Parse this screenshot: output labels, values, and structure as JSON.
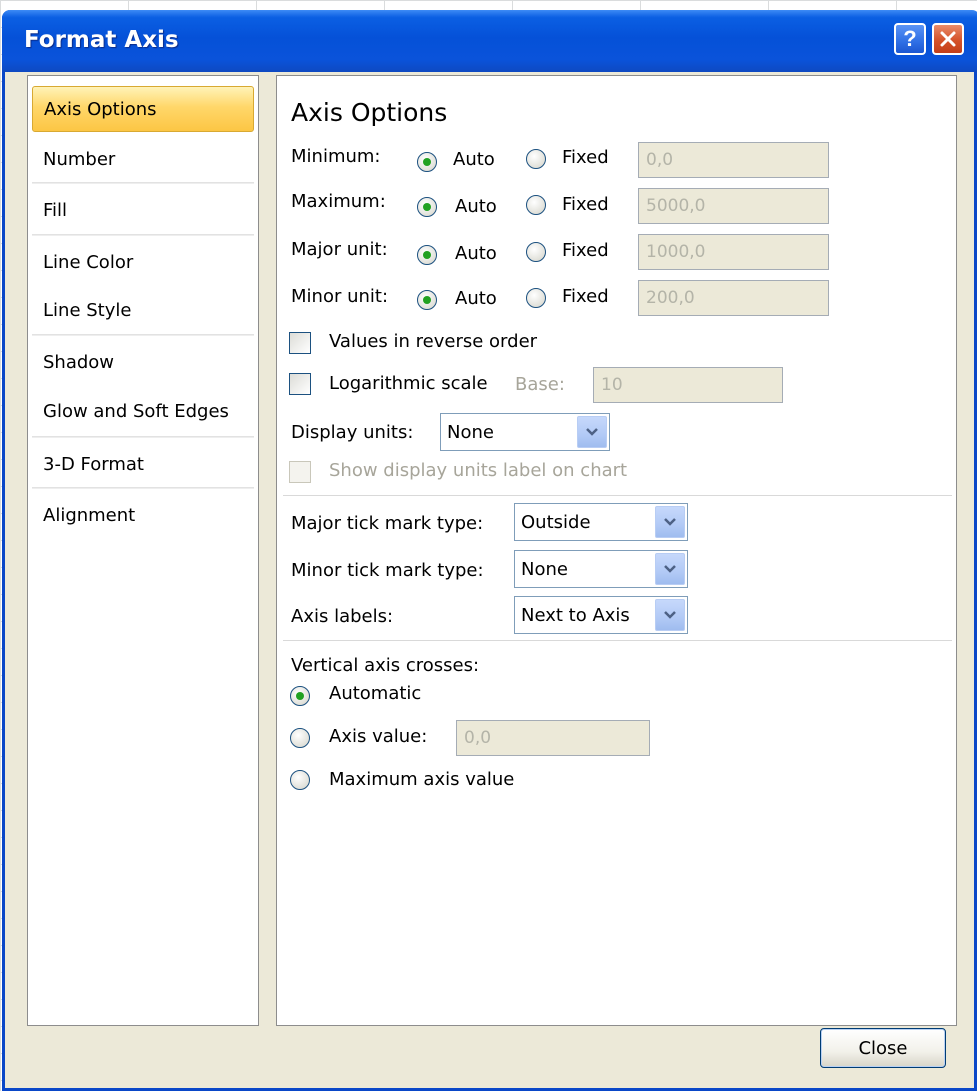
{
  "dialog": {
    "title": "Format Axis",
    "help_button": "?",
    "close_button_label": "Close"
  },
  "categories": [
    {
      "label": "Axis Options",
      "selected": true
    },
    {
      "label": "Number"
    },
    {
      "label": "Fill"
    },
    {
      "label": "Line Color"
    },
    {
      "label": "Line Style"
    },
    {
      "label": "Shadow"
    },
    {
      "label": "Glow and Soft Edges"
    },
    {
      "label": "3-D Format"
    },
    {
      "label": "Alignment"
    }
  ],
  "axis_options": {
    "heading": "Axis Options",
    "rows": [
      {
        "label": "Minimum:",
        "auto": "Auto",
        "fixed": "Fixed",
        "value": "0,0",
        "selected": "Auto"
      },
      {
        "label": "Maximum:",
        "auto": "Auto",
        "fixed": "Fixed",
        "value": "5000,0",
        "selected": "Auto"
      },
      {
        "label": "Major unit:",
        "auto": "Auto",
        "fixed": "Fixed",
        "value": "1000,0",
        "selected": "Auto"
      },
      {
        "label": "Minor unit:",
        "auto": "Auto",
        "fixed": "Fixed",
        "value": "200,0",
        "selected": "Auto"
      }
    ],
    "reverse_order": {
      "label": "Values in reverse order",
      "checked": false
    },
    "log_scale": {
      "label": "Logarithmic scale",
      "checked": false,
      "base_label": "Base:",
      "base_value": "10"
    },
    "display_units": {
      "label": "Display units:",
      "value": "None"
    },
    "show_units_label": {
      "label": "Show display units label on chart",
      "checked": false,
      "enabled": false
    },
    "major_tick": {
      "label": "Major tick mark type:",
      "value": "Outside"
    },
    "minor_tick": {
      "label": "Minor tick mark type:",
      "value": "None"
    },
    "axis_labels": {
      "label": "Axis labels:",
      "value": "Next to Axis"
    },
    "crosses": {
      "heading": "Vertical axis crosses:",
      "automatic": "Automatic",
      "axis_value": "Axis value:",
      "axis_value_field": "0,0",
      "maximum": "Maximum axis value",
      "selected": "Automatic"
    }
  },
  "colors": {
    "title_bar": "#0551d8",
    "dialog_bg": "#ece9d8",
    "selected_category": "#fcc644",
    "radio_dot": "#21a121"
  }
}
